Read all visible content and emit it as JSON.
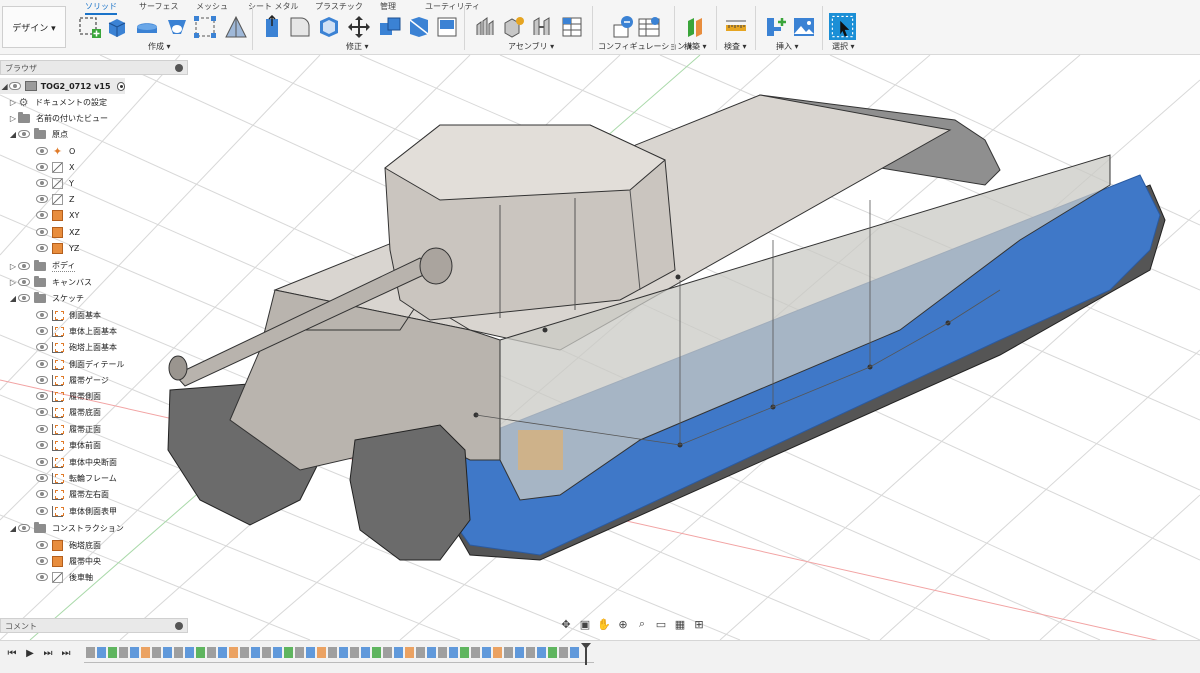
{
  "workspace": {
    "label": "デザイン ▾"
  },
  "tabs": [
    "ソリッド",
    "サーフェス",
    "メッシュ",
    "シート メタル",
    "プラスチック",
    "管理",
    "ユーティリティ"
  ],
  "groups": {
    "create": "作成 ▾",
    "modify": "修正 ▾",
    "assemble": "アセンブリ ▾",
    "configure": "コンフィギュレーション ▾",
    "construct": "構築 ▾",
    "inspect": "検査 ▾",
    "insert": "挿入 ▾",
    "select": "選択 ▾"
  },
  "browser": {
    "title": "ブラウザ",
    "document": "TOG2_0712 v15",
    "items": [
      "ドキュメントの設定",
      "名前の付いたビュー",
      "原点",
      "O",
      "X",
      "Y",
      "Z",
      "XY",
      "XZ",
      "YZ",
      "ボディ",
      "キャンバス",
      "スケッチ",
      "側面基本",
      "車体上面基本",
      "砲塔上面基本",
      "側面ディテール",
      "履帯ゲージ",
      "履帯側面",
      "履帯底面",
      "履帯正面",
      "車体前面",
      "車体中央断面",
      "転輪フレーム",
      "履帯左右面",
      "車体側面表甲",
      "コンストラクション",
      "砲塔底面",
      "履帯中央",
      "後車軸"
    ]
  },
  "comment": {
    "title": "コメント"
  },
  "colors": {
    "accent": "#1a73c9",
    "body_blue": "#3f78c8",
    "hull_grey": "#cfcac4",
    "plane_orange": "#e88d3d"
  }
}
